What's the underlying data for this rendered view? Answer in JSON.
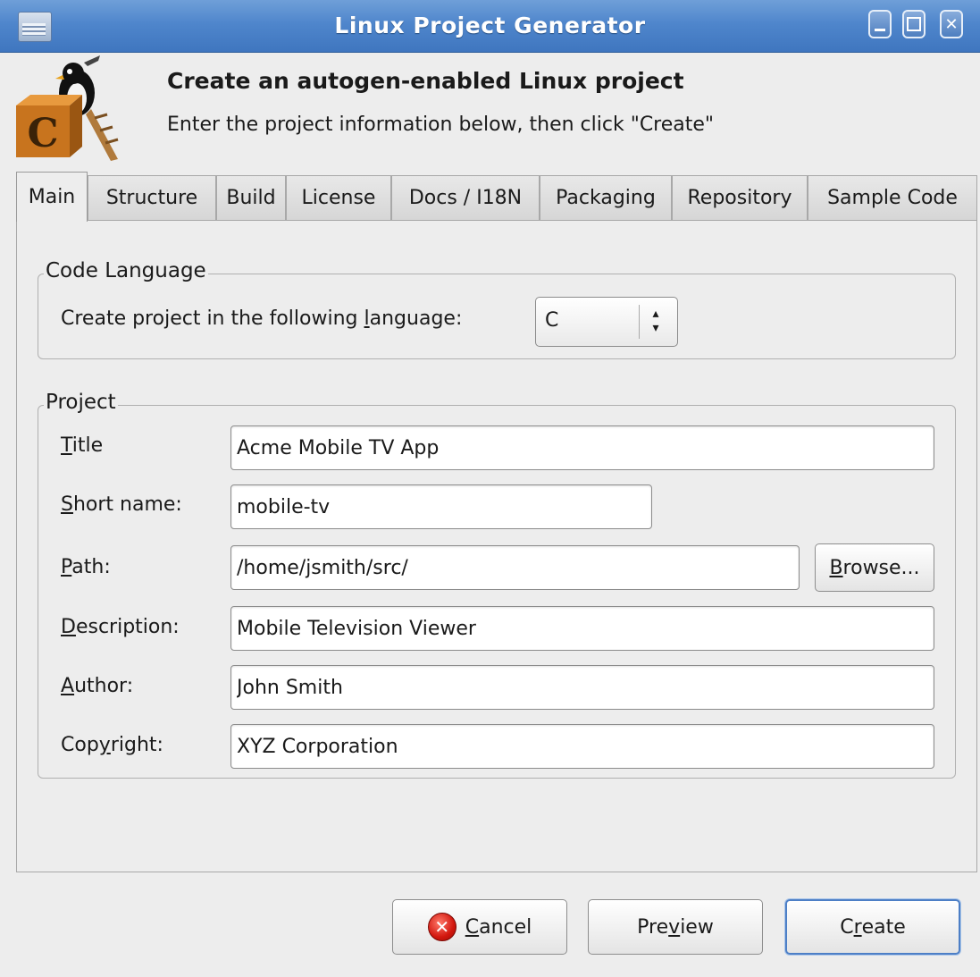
{
  "window": {
    "title": "Linux Project Generator"
  },
  "header": {
    "heading": "Create an autogen-enabled Linux project",
    "subheading": "Enter the project information below, then click \"Create\"",
    "logo_letter": "C"
  },
  "tabs": [
    "Main",
    "Structure",
    "Build",
    "License",
    "Docs / I18N",
    "Packaging",
    "Repository",
    "Sample Code"
  ],
  "code_language": {
    "legend": "Code Language",
    "label_pre": "Create project in the following ",
    "label_mnemonic": "l",
    "label_post": "anguage:",
    "selected": "C"
  },
  "project": {
    "legend": "Project",
    "title_label": [
      "T",
      "itle"
    ],
    "title_value": "Acme Mobile TV App",
    "short_name_label": [
      "S",
      "hort name:"
    ],
    "short_name_value": "mobile-tv",
    "path_label": [
      "P",
      "ath:"
    ],
    "path_value": "/home/jsmith/src/",
    "browse_label": [
      "B",
      "rowse..."
    ],
    "description_label": [
      "D",
      "escription:"
    ],
    "description_value": "Mobile Television Viewer",
    "author_label": [
      "A",
      "uthor:"
    ],
    "author_value": "John Smith",
    "copyright_label": [
      "Cop",
      "y",
      "right:"
    ],
    "copyright_value": "XYZ Corporation"
  },
  "buttons": {
    "cancel": [
      "C",
      "ancel"
    ],
    "preview": [
      "Pre",
      "v",
      "iew"
    ],
    "create": [
      "C",
      "r",
      "eate"
    ]
  }
}
